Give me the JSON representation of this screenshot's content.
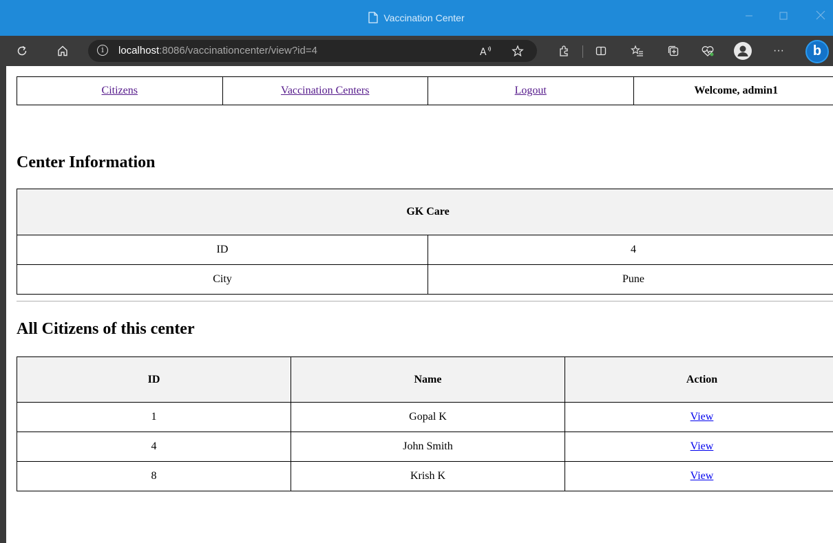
{
  "window": {
    "title": "Vaccination Center"
  },
  "browser": {
    "url_host": "localhost",
    "url_rest": ":8086/vaccinationcenter/view?id=4",
    "more_label": "···"
  },
  "nav": {
    "citizens": "Citizens",
    "centers": "Vaccination Centers",
    "logout": "Logout",
    "welcome": "Welcome, admin1"
  },
  "center": {
    "heading": "Center Information",
    "name": "GK Care",
    "rows": [
      {
        "label": "ID",
        "value": "4"
      },
      {
        "label": "City",
        "value": "Pune"
      }
    ]
  },
  "citizens": {
    "heading": "All Citizens of this center",
    "columns": [
      "ID",
      "Name",
      "Action"
    ],
    "rows": [
      {
        "id": "1",
        "name": "Gopal K",
        "action": "View"
      },
      {
        "id": "4",
        "name": "John Smith",
        "action": "View"
      },
      {
        "id": "8",
        "name": "Krish K",
        "action": "View"
      }
    ]
  },
  "colors": {
    "titlebar": "#1f8ad9",
    "toolbar": "#3b3b3b",
    "visited_link": "#551a8b",
    "link": "#0000ee",
    "header_bg": "#f2f2f2"
  },
  "icons": [
    "document-icon",
    "minimize-icon",
    "maximize-icon",
    "close-icon",
    "refresh-icon",
    "home-icon",
    "info-icon",
    "read-aloud-icon",
    "favorite-star-icon",
    "extensions-icon",
    "split-screen-icon",
    "favorites-icon",
    "collections-icon",
    "browser-essentials-icon",
    "profile-icon",
    "more-icon",
    "bing-copilot-icon"
  ]
}
